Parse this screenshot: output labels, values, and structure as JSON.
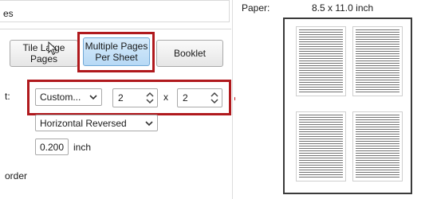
{
  "top_section": {
    "label": "es"
  },
  "layout_buttons": [
    {
      "label": "Tile Large Pages",
      "selected": false
    },
    {
      "label": "Multiple Pages Per Sheet",
      "selected": true
    },
    {
      "label": "Booklet",
      "selected": false
    }
  ],
  "pages_per_sheet": {
    "row_label": "t:",
    "preset": "Custom...",
    "columns": "2",
    "times_symbol": "x",
    "rows": "2"
  },
  "page_order": {
    "value": "Horizontal Reversed"
  },
  "margin": {
    "value": "0.200",
    "unit": "inch"
  },
  "border_option": {
    "label": "order"
  },
  "preview": {
    "paper_label": "Paper:",
    "paper_size": "8.5 x 11.0 inch"
  },
  "colors": {
    "highlight_frame": "#b0191d",
    "selected_button": "#c8e2f8"
  }
}
